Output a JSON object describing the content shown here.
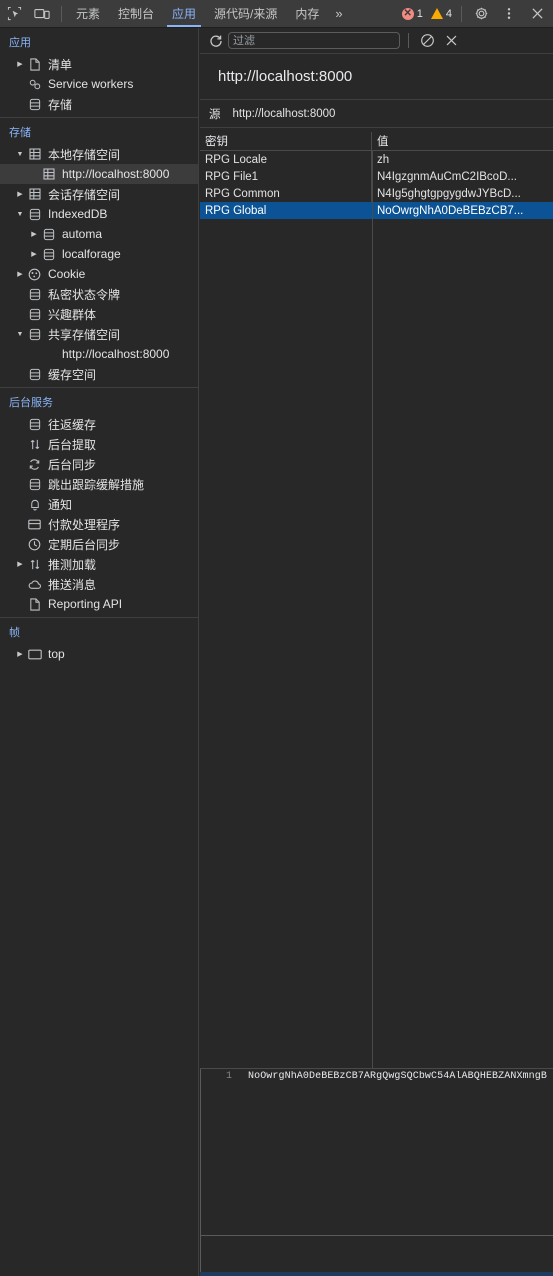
{
  "window": {
    "title": "Chrome DevTools - Application - Local Storage"
  },
  "tabbar": {
    "inspect_icon": "inspect-element-icon",
    "device_icon": "device-toolbar-icon",
    "tabs": [
      {
        "label": "元素",
        "name": "tab-elements",
        "active": false
      },
      {
        "label": "控制台",
        "name": "tab-console",
        "active": false
      },
      {
        "label": "应用",
        "name": "tab-application",
        "active": true
      },
      {
        "label": "源代码/来源",
        "name": "tab-sources",
        "active": false
      },
      {
        "label": "内存",
        "name": "tab-memory",
        "active": false
      }
    ],
    "more_label": "»",
    "error_count": "1",
    "warning_count": "4",
    "settings_icon": "gear-icon",
    "menu_icon": "kebab-menu-icon",
    "close_icon": "close-icon",
    "accent_color": "#8ab4f8",
    "error_color": "#f28b82",
    "warning_color": "#f9ab00"
  },
  "sidebar": {
    "sections": [
      {
        "title": "应用",
        "name": "section-application",
        "items": [
          {
            "label": "清单",
            "icon": "manifest-file-icon",
            "arrow": "closed",
            "indent": 1,
            "name": "sidebar-item-manifest"
          },
          {
            "label": "Service workers",
            "icon": "service-worker-gears-icon",
            "arrow": "none",
            "indent": 1,
            "name": "sidebar-item-service-workers"
          },
          {
            "label": "存储",
            "icon": "database-icon",
            "arrow": "none",
            "indent": 1,
            "name": "sidebar-item-storage"
          }
        ]
      },
      {
        "title": "存储",
        "name": "section-storage",
        "items": [
          {
            "label": "本地存储空间",
            "icon": "table-grid-icon",
            "arrow": "open",
            "indent": 1,
            "name": "sidebar-item-local-storage"
          },
          {
            "label": "http://localhost:8000",
            "icon": "table-grid-icon",
            "arrow": "none",
            "indent": 2,
            "name": "sidebar-item-local-storage-origin",
            "selected": true
          },
          {
            "label": "会话存储空间",
            "icon": "table-grid-icon",
            "arrow": "closed",
            "indent": 1,
            "name": "sidebar-item-session-storage"
          },
          {
            "label": "IndexedDB",
            "icon": "database-icon",
            "arrow": "open",
            "indent": 1,
            "name": "sidebar-item-indexeddb"
          },
          {
            "label": "automa",
            "icon": "database-icon",
            "arrow": "closed",
            "indent": 2,
            "name": "sidebar-item-indexeddb-automa"
          },
          {
            "label": "localforage",
            "icon": "database-icon",
            "arrow": "closed",
            "indent": 2,
            "name": "sidebar-item-indexeddb-localforage"
          },
          {
            "label": "Cookie",
            "icon": "cookie-icon",
            "arrow": "closed",
            "indent": 1,
            "name": "sidebar-item-cookie"
          },
          {
            "label": "私密状态令牌",
            "icon": "database-icon",
            "arrow": "none",
            "indent": 1,
            "name": "sidebar-item-private-state-tokens"
          },
          {
            "label": "兴趣群体",
            "icon": "database-icon",
            "arrow": "none",
            "indent": 1,
            "name": "sidebar-item-interest-groups"
          },
          {
            "label": "共享存储空间",
            "icon": "database-icon",
            "arrow": "open",
            "indent": 1,
            "name": "sidebar-item-shared-storage"
          },
          {
            "label": "http://localhost:8000",
            "icon": "none",
            "arrow": "none",
            "indent": 2,
            "name": "sidebar-item-shared-storage-origin"
          },
          {
            "label": "缓存空间",
            "icon": "database-icon",
            "arrow": "none",
            "indent": 1,
            "name": "sidebar-item-cache-storage"
          }
        ]
      },
      {
        "title": "后台服务",
        "name": "section-background-services",
        "items": [
          {
            "label": "往返缓存",
            "icon": "database-icon",
            "arrow": "none",
            "indent": 1,
            "name": "sidebar-item-back-forward-cache"
          },
          {
            "label": "后台提取",
            "icon": "arrows-updown-icon",
            "arrow": "none",
            "indent": 1,
            "name": "sidebar-item-background-fetch"
          },
          {
            "label": "后台同步",
            "icon": "sync-icon",
            "arrow": "none",
            "indent": 1,
            "name": "sidebar-item-background-sync"
          },
          {
            "label": "跳出跟踪缓解措施",
            "icon": "database-icon",
            "arrow": "none",
            "indent": 1,
            "name": "sidebar-item-bounce-tracking"
          },
          {
            "label": "通知",
            "icon": "bell-icon",
            "arrow": "none",
            "indent": 1,
            "name": "sidebar-item-notifications"
          },
          {
            "label": "付款处理程序",
            "icon": "payment-icon",
            "arrow": "none",
            "indent": 1,
            "name": "sidebar-item-payment-handler"
          },
          {
            "label": "定期后台同步",
            "icon": "clock-icon",
            "arrow": "none",
            "indent": 1,
            "name": "sidebar-item-periodic-background-sync"
          },
          {
            "label": "推测加载",
            "icon": "arrows-updown-icon",
            "arrow": "closed",
            "indent": 1,
            "name": "sidebar-item-speculative-loads"
          },
          {
            "label": "推送消息",
            "icon": "cloud-icon",
            "arrow": "none",
            "indent": 1,
            "name": "sidebar-item-push-messaging"
          },
          {
            "label": "Reporting API",
            "icon": "file-icon",
            "arrow": "none",
            "indent": 1,
            "name": "sidebar-item-reporting-api"
          }
        ]
      },
      {
        "title": "帧",
        "name": "section-frames",
        "items": [
          {
            "label": "top",
            "icon": "frame-icon",
            "arrow": "closed",
            "indent": 1,
            "name": "sidebar-item-frame-top"
          }
        ]
      }
    ]
  },
  "panel": {
    "toolbar": {
      "refresh_icon": "refresh-icon",
      "filter_placeholder": "过滤",
      "filter_value": "",
      "clear_icon": "clear-all-icon",
      "delete_icon": "delete-selected-icon"
    },
    "origin_title": "http://localhost:8000",
    "origin_label": "源",
    "origin_value": "http://localhost:8000",
    "table": {
      "columns": [
        "密钥",
        "值"
      ],
      "rows": [
        {
          "key": "RPG Locale",
          "value": "zh",
          "selected": false
        },
        {
          "key": "RPG File1",
          "value": "N4IgzgnmAuCmC2IBcoD...",
          "selected": false
        },
        {
          "key": "RPG Common",
          "value": "N4Ig5ghgtgpgygdwJYBcD...",
          "selected": false
        },
        {
          "key": "RPG Global",
          "value": "NoOwrgNhA0DeBEBzCB7...",
          "selected": true
        }
      ],
      "selected_row_color": "#0b5394"
    },
    "preview": {
      "line_number": "1",
      "content": "NoOwrgNhA0DeBEBzCB7ARgQwgSQCbwC54AlABQHEBZANXmngB"
    }
  }
}
